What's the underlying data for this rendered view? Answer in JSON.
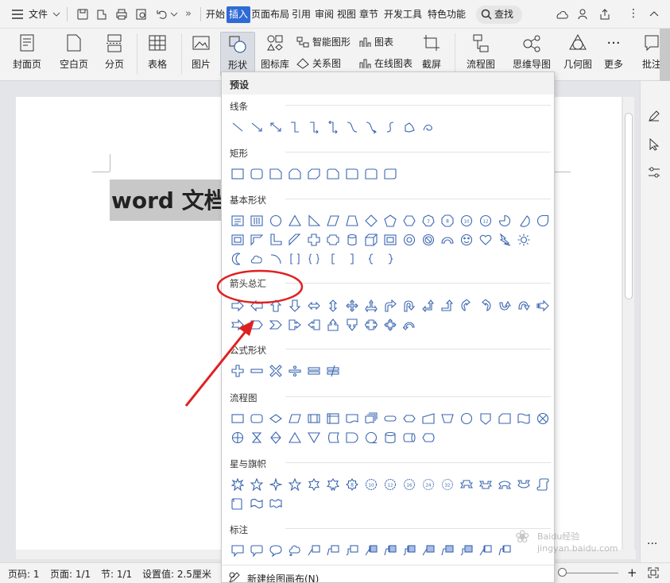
{
  "menubar": {
    "file_label": "文件",
    "tabs": [
      "开始",
      "插入",
      "页面布局",
      "引用",
      "审阅",
      "视图",
      "章节",
      "开发工具",
      "特色功能"
    ],
    "active_tab": "插入",
    "search_label": "查找"
  },
  "ribbon": {
    "cover_label": "封面页",
    "blank_label": "空白页",
    "pagebreak_label": "分页",
    "table_label": "表格",
    "picture_label": "图片",
    "shape_label": "形状",
    "iconlib_label": "图标库",
    "smartart_label": "智能图形",
    "chart_label": "图表",
    "relation_label": "关系图",
    "onlinechart_label": "在线图表",
    "screenshot_label": "截屏",
    "flowchart_label": "流程图",
    "mindmap_label": "思维导图",
    "geometry_label": "几何图",
    "more_label": "更多",
    "comment_label": "批注"
  },
  "document": {
    "heading": "word 文档"
  },
  "shapes_panel": {
    "preset_title": "预设",
    "sections": {
      "lines": "线条",
      "rectangles": "矩形",
      "basic": "基本形状",
      "arrows": "箭头总汇",
      "formula": "公式形状",
      "flowchart": "流程图",
      "stars": "星与旗帜",
      "callouts": "标注"
    },
    "new_canvas_label": "新建绘图画布(N)"
  },
  "statusbar": {
    "page_label": "页码: 1",
    "pages_label": "页面: 1/1",
    "section_label": "节: 1/1",
    "setting_label": "设置值: 2.5厘米"
  },
  "watermark": "Baidu经验 jingyan.baidu.com",
  "colors": {
    "accent": "#3a66b0",
    "active_tab_bg": "#2f6bd6",
    "annotation_red": "#e02020"
  }
}
